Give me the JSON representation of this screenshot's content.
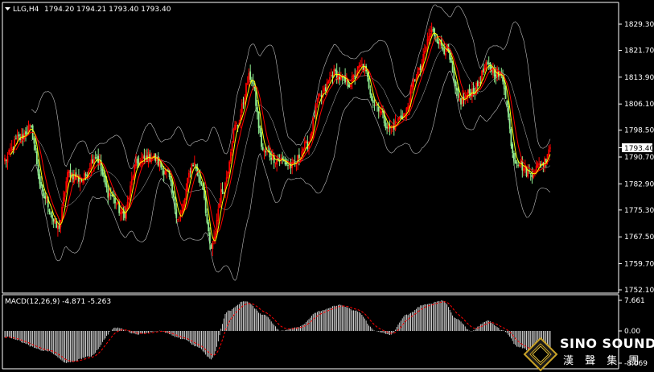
{
  "header": {
    "symbol": "LLG,H4",
    "ohlc": "1794.20 1794.21 1793.40 1793.40"
  },
  "price_box": "1793.40",
  "price_axis": {
    "ticks": [
      "1829.30",
      "1821.70",
      "1813.90",
      "1806.10",
      "1798.50",
      "1790.70",
      "1782.90",
      "1775.30",
      "1767.50",
      "1759.70",
      "1752.10"
    ],
    "values": [
      1829.3,
      1821.7,
      1813.9,
      1806.1,
      1798.5,
      1790.7,
      1782.9,
      1775.3,
      1767.5,
      1759.7,
      1752.1
    ]
  },
  "macd_panel": {
    "label": "MACD(12,26,9) -4.871 -5.263",
    "ticks": [
      "7.661",
      "0.00",
      "-8.069"
    ]
  },
  "brand": {
    "name": "SINO SOUND",
    "chinese": "漢 聲 集 團"
  },
  "colors": {
    "background": "#000000",
    "bull": "#ff0000",
    "bear": "#90ee90",
    "ma_fast": "#ffff00",
    "ma_slow": "#ff0000",
    "bands": "#c0c0c0",
    "macd_hist": "#ffffff",
    "macd_signal": "#ff0000"
  },
  "chart_data": {
    "type": "candlestick",
    "price_anchors": [
      [
        0,
        1790
      ],
      [
        10,
        1796
      ],
      [
        18,
        1799
      ],
      [
        28,
        1779
      ],
      [
        38,
        1770
      ],
      [
        46,
        1786
      ],
      [
        55,
        1784
      ],
      [
        65,
        1791
      ],
      [
        75,
        1780
      ],
      [
        85,
        1774
      ],
      [
        95,
        1789
      ],
      [
        105,
        1791
      ],
      [
        115,
        1787
      ],
      [
        125,
        1773
      ],
      [
        135,
        1789
      ],
      [
        141,
        1783
      ],
      [
        148,
        1764
      ],
      [
        156,
        1781
      ],
      [
        166,
        1800
      ],
      [
        176,
        1814
      ],
      [
        186,
        1792
      ],
      [
        196,
        1790
      ],
      [
        206,
        1788
      ],
      [
        216,
        1794
      ],
      [
        226,
        1808
      ],
      [
        236,
        1815
      ],
      [
        246,
        1812
      ],
      [
        256,
        1817
      ],
      [
        266,
        1806
      ],
      [
        276,
        1799
      ],
      [
        286,
        1803
      ],
      [
        296,
        1815
      ],
      [
        306,
        1827
      ],
      [
        316,
        1822
      ],
      [
        326,
        1807
      ],
      [
        336,
        1810
      ],
      [
        346,
        1817
      ],
      [
        356,
        1814
      ],
      [
        366,
        1790
      ],
      [
        376,
        1786
      ],
      [
        386,
        1789
      ],
      [
        391,
        1794
      ]
    ],
    "macd_anchors": [
      [
        0,
        -1.5
      ],
      [
        30,
        -5
      ],
      [
        45,
        -8
      ],
      [
        60,
        -6.5
      ],
      [
        80,
        0.8
      ],
      [
        95,
        -0.8
      ],
      [
        110,
        0
      ],
      [
        128,
        -2
      ],
      [
        138,
        -4
      ],
      [
        148,
        -7
      ],
      [
        160,
        5
      ],
      [
        172,
        7.5
      ],
      [
        186,
        4
      ],
      [
        198,
        0
      ],
      [
        210,
        1
      ],
      [
        226,
        5
      ],
      [
        240,
        6.5
      ],
      [
        252,
        5
      ],
      [
        266,
        0
      ],
      [
        276,
        -1
      ],
      [
        288,
        4
      ],
      [
        300,
        6.5
      ],
      [
        314,
        7.6
      ],
      [
        324,
        3
      ],
      [
        334,
        0
      ],
      [
        346,
        2.5
      ],
      [
        358,
        0
      ],
      [
        368,
        -4
      ],
      [
        380,
        -5.5
      ],
      [
        391,
        -4.87
      ]
    ],
    "signal_last": -5.263,
    "bar_count": 392
  }
}
